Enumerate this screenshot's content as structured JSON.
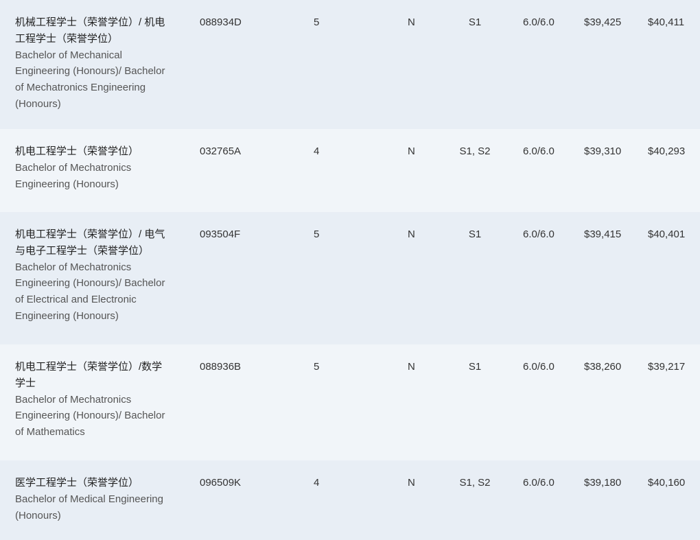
{
  "rows": [
    {
      "name_cn": "机械工程学士（荣誉学位）/ 机电工程学士（荣誉学位）",
      "name_en": "Bachelor of Mechanical Engineering (Honours)/ Bachelor of Mechatronics Engineering (Honours)",
      "cricos": "088934D",
      "years": "5",
      "flag": "N",
      "intake": "S1",
      "ielts": "6.0/6.0",
      "fee_a": "$39,425",
      "fee_b": "$40,411"
    },
    {
      "name_cn": "机电工程学士（荣誉学位）",
      "name_en": "Bachelor of Mechatronics Engineering (Honours)",
      "cricos": "032765A",
      "years": "4",
      "flag": "N",
      "intake": "S1, S2",
      "ielts": "6.0/6.0",
      "fee_a": "$39,310",
      "fee_b": "$40,293"
    },
    {
      "name_cn": "机电工程学士（荣誉学位）/ 电气与电子工程学士（荣誉学位）",
      "name_en": "Bachelor of Mechatronics Engineering (Honours)/ Bachelor of Electrical and Electronic Engineering (Honours)",
      "cricos": "093504F",
      "years": "5",
      "flag": "N",
      "intake": "S1",
      "ielts": "6.0/6.0",
      "fee_a": "$39,415",
      "fee_b": "$40,401"
    },
    {
      "name_cn": "机电工程学士（荣誉学位）/数学学士",
      "name_en": "Bachelor of Mechatronics Engineering (Honours)/ Bachelor of Mathematics",
      "cricos": "088936B",
      "years": "5",
      "flag": "N",
      "intake": "S1",
      "ielts": "6.0/6.0",
      "fee_a": "$38,260",
      "fee_b": "$39,217"
    },
    {
      "name_cn": "医学工程学士（荣誉学位）",
      "name_en": "Bachelor of Medical Engineering (Honours)",
      "cricos": "096509K",
      "years": "4",
      "flag": "N",
      "intake": "S1, S2",
      "ielts": "6.0/6.0",
      "fee_a": "$39,180",
      "fee_b": "$40,160"
    }
  ]
}
